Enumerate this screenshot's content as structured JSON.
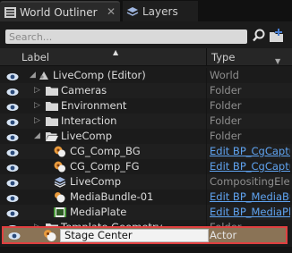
{
  "tabs": [
    {
      "label": "World Outliner",
      "icon": "list-icon",
      "active": true,
      "close": "✕"
    },
    {
      "label": "Layers",
      "icon": "layers-icon",
      "active": false
    }
  ],
  "search": {
    "placeholder": "Search..."
  },
  "header": {
    "label": "Label",
    "type": "Type"
  },
  "rows": [
    {
      "label": "LiveComp (Editor)",
      "type": "World",
      "link": false,
      "icon": "world-icon",
      "expanded": true
    },
    {
      "label": "Cameras",
      "type": "Folder",
      "link": false,
      "icon": "folder-icon",
      "expanded": false
    },
    {
      "label": "Environment",
      "type": "Folder",
      "link": false,
      "icon": "folder-icon",
      "expanded": false
    },
    {
      "label": "Interaction",
      "type": "Folder",
      "link": false,
      "icon": "folder-icon",
      "expanded": false
    },
    {
      "label": "LiveComp",
      "type": "Folder",
      "link": false,
      "icon": "folder-open-icon",
      "expanded": true
    },
    {
      "label": "CG_Comp_BG",
      "type": "Edit BP_CgCaptu",
      "link": true,
      "icon": "cg-capture-icon"
    },
    {
      "label": "CG_Comp_FG",
      "type": "Edit BP_CgCaptu",
      "link": true,
      "icon": "cg-capture-icon"
    },
    {
      "label": "LiveComp",
      "type": "CompositingElem",
      "link": false,
      "icon": "compositing-icon"
    },
    {
      "label": "MediaBundle-01",
      "type": "Edit BP_MediaBu",
      "link": true,
      "icon": "media-bundle-icon"
    },
    {
      "label": "MediaPlate",
      "type": "Edit BP_MediaPl",
      "link": true,
      "icon": "media-plate-icon"
    },
    {
      "label": "Template Geometry",
      "type": "Folder",
      "link": false,
      "icon": "folder-icon",
      "expanded": false
    }
  ],
  "selected": {
    "label": "Stage Center",
    "type": "Actor",
    "icon": "actor-icon"
  },
  "colors": {
    "link": "#5fa3f0",
    "selection": "#8a7356",
    "highlight_border": "#e04040",
    "folder": "#d8d8d8"
  }
}
